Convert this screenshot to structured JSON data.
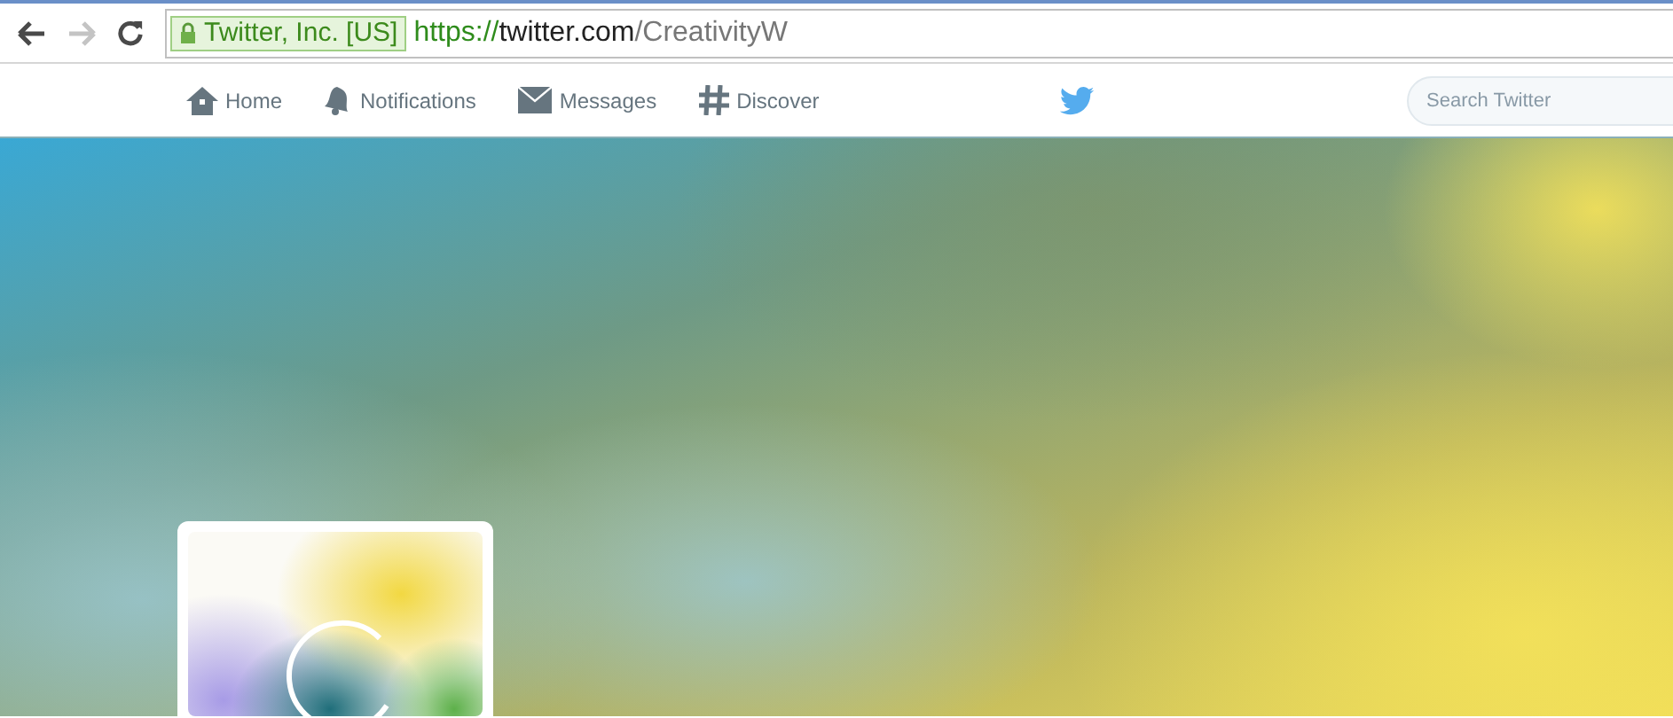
{
  "browser": {
    "nav_buttons": [
      {
        "kind": "back",
        "disabled": false
      },
      {
        "kind": "forward",
        "disabled": true
      },
      {
        "kind": "reload",
        "disabled": false
      }
    ],
    "security_badge": {
      "label": "Twitter, Inc. [US]"
    },
    "address": {
      "scheme": "https://",
      "host": "twitter.com",
      "path": "/CreativityW"
    }
  },
  "nav": {
    "items": [
      {
        "kind": "home",
        "label": "Home"
      },
      {
        "kind": "notifications",
        "label": "Notifications"
      },
      {
        "kind": "messages",
        "label": "Messages"
      },
      {
        "kind": "discover",
        "label": "Discover"
      }
    ]
  },
  "search": {
    "placeholder": "Search Twitter"
  }
}
